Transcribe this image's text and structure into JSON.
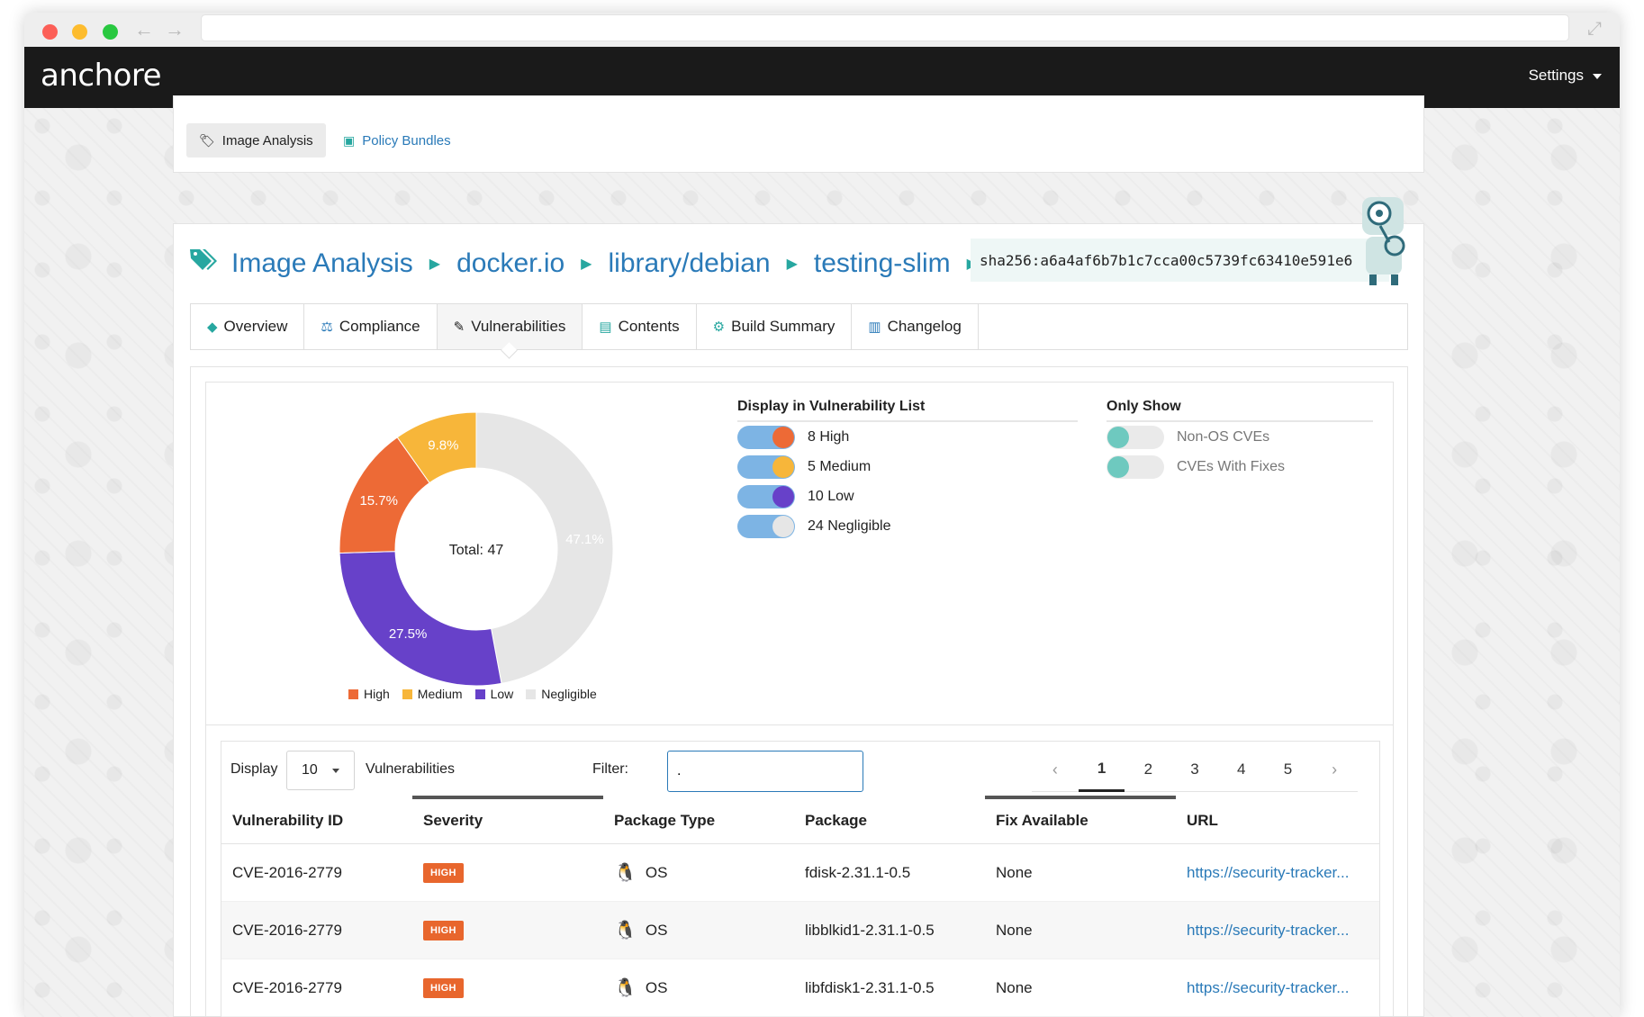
{
  "app": {
    "logo": "anchore",
    "settings_label": "Settings"
  },
  "subnav": {
    "items": [
      {
        "label": "Image Analysis",
        "icon": "tags-icon"
      },
      {
        "label": "Policy Bundles",
        "icon": "briefcase-icon"
      }
    ]
  },
  "breadcrumb": {
    "items": [
      "Image Analysis",
      "docker.io",
      "library/debian",
      "testing-slim"
    ],
    "digest": "sha256:a6a4af6b7b1c7cca00c5739fc63410e591e6"
  },
  "tabs": [
    {
      "label": "Overview",
      "icon": "tag-icon"
    },
    {
      "label": "Compliance",
      "icon": "balance-scale-icon"
    },
    {
      "label": "Vulnerabilities",
      "icon": "fire-extinguisher-icon"
    },
    {
      "label": "Contents",
      "icon": "file-icon"
    },
    {
      "label": "Build Summary",
      "icon": "cogs-icon"
    },
    {
      "label": "Changelog",
      "icon": "book-icon"
    }
  ],
  "chart_data": {
    "type": "pie",
    "center_label": "Total: 47",
    "categories": [
      "High",
      "Medium",
      "Low",
      "Negligible"
    ],
    "values": [
      15.7,
      9.8,
      27.5,
      47.1
    ],
    "slice_labels": [
      "15.7%",
      "9.8%",
      "27.5%",
      "47.1%"
    ],
    "colors": [
      "#ed6a36",
      "#f7b63a",
      "#6741c9",
      "#e6e6e6"
    ],
    "legend_position": "bottom"
  },
  "display_list": {
    "title": "Display in Vulnerability List",
    "items": [
      {
        "label": "8 High",
        "knob_color": "#ed6a36"
      },
      {
        "label": "5 Medium",
        "knob_color": "#f7b63a"
      },
      {
        "label": "10 Low",
        "knob_color": "#6741c9"
      },
      {
        "label": "24 Negligible",
        "knob_color": "#e6e6e6"
      }
    ]
  },
  "only_show": {
    "title": "Only Show",
    "items": [
      {
        "label": "Non-OS CVEs",
        "knob_color": "#6ec9bf"
      },
      {
        "label": "CVEs With Fixes",
        "knob_color": "#6ec9bf"
      }
    ]
  },
  "table_controls": {
    "display_label": "Display",
    "page_size": "10",
    "suffix_label": "Vulnerabilities",
    "filter_label": "Filter:",
    "filter_value": ".",
    "pages": [
      "1",
      "2",
      "3",
      "4",
      "5"
    ],
    "prev": "‹",
    "next": "›",
    "current_page": "1"
  },
  "table": {
    "columns": [
      "Vulnerability ID",
      "Severity",
      "Package Type",
      "Package",
      "Fix Available",
      "URL"
    ],
    "rows": [
      {
        "id": "CVE-2016-2779",
        "severity": "HIGH",
        "type": "OS",
        "package": "fdisk-2.31.1-0.5",
        "fix": "None",
        "url": "https://security-tracker..."
      },
      {
        "id": "CVE-2016-2779",
        "severity": "HIGH",
        "type": "OS",
        "package": "libblkid1-2.31.1-0.5",
        "fix": "None",
        "url": "https://security-tracker..."
      },
      {
        "id": "CVE-2016-2779",
        "severity": "HIGH",
        "type": "OS",
        "package": "libfdisk1-2.31.1-0.5",
        "fix": "None",
        "url": "https://security-tracker..."
      }
    ]
  }
}
